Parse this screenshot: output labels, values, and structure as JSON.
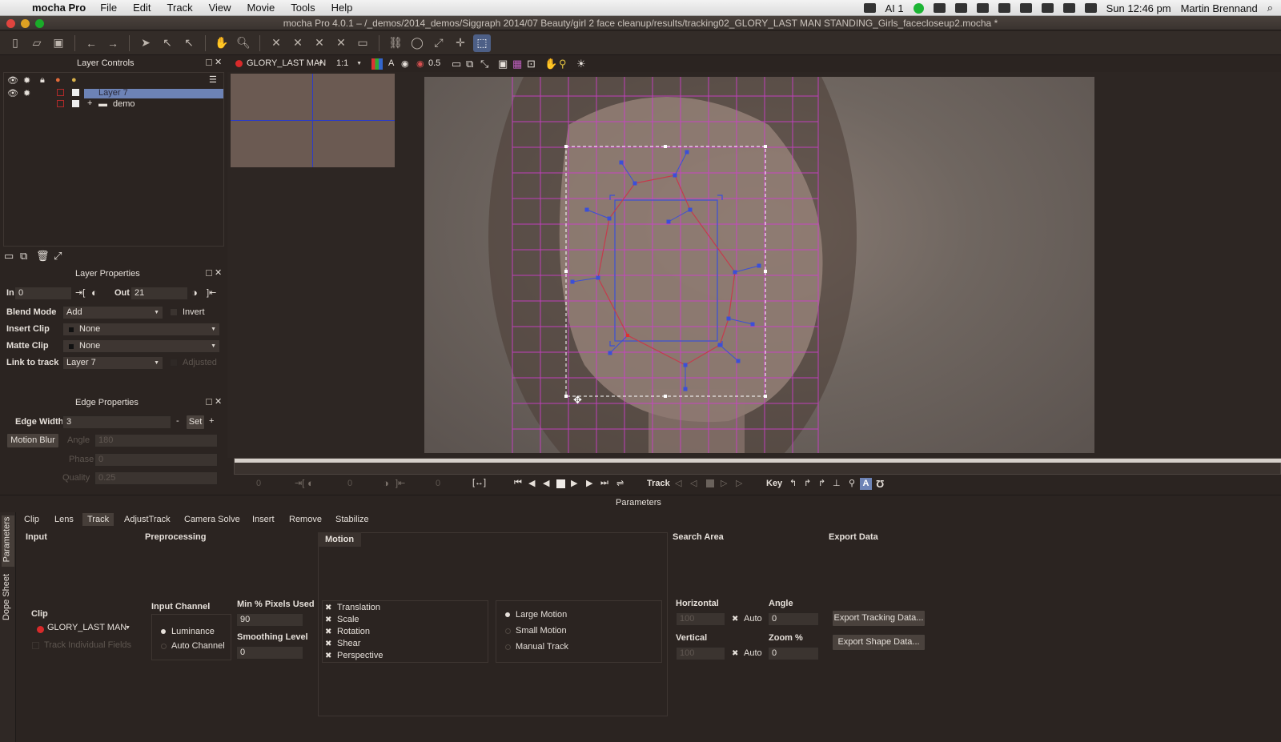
{
  "menubar": {
    "app": "mocha Pro",
    "items": [
      "File",
      "Edit",
      "Track",
      "View",
      "Movie",
      "Tools",
      "Help"
    ],
    "status_ai": "AI 1",
    "clock": "Sun 12:46 pm",
    "user": "Martin Brennand"
  },
  "window": {
    "title": "mocha Pro 4.0.1 – /_demos/2014_demos/Siggraph 2014/07 Beauty/girl 2 face cleanup/results/tracking02_GLORY_LAST MAN STANDING_Girls_facecloseup2.mocha *"
  },
  "layer_controls": {
    "title": "Layer Controls",
    "layers": [
      {
        "name": "Layer 7",
        "selected": true
      },
      {
        "name": "demo",
        "selected": false
      }
    ]
  },
  "viewer": {
    "clip_name": "GLORY_LAST MAN",
    "zoom": "1:1",
    "channel": "A",
    "opacity": "0.5"
  },
  "layer_properties": {
    "title": "Layer Properties",
    "in_label": "In",
    "in_value": "0",
    "out_label": "Out",
    "out_value": "21",
    "blend_mode_label": "Blend Mode",
    "blend_mode": "Add",
    "invert_label": "Invert",
    "insert_clip_label": "Insert Clip",
    "insert_clip": "None",
    "matte_clip_label": "Matte Clip",
    "matte_clip": "None",
    "link_to_track_label": "Link to track",
    "link_to_track": "Layer 7",
    "adjusted_label": "Adjusted"
  },
  "edge_properties": {
    "title": "Edge Properties",
    "edge_width_label": "Edge Width",
    "edge_width": "3",
    "set_label": "Set",
    "minus_label": "-",
    "plus_label": "+",
    "motion_blur_label": "Motion Blur",
    "angle_label": "Angle",
    "angle_value": "180",
    "phase_label": "Phase",
    "phase_value": "0",
    "quality_label": "Quality",
    "quality_value": "0.25"
  },
  "transport": {
    "track_label": "Track",
    "key_label": "Key"
  },
  "parameters": {
    "title": "Parameters",
    "side_tabs": [
      "Parameters",
      "Dope Sheet"
    ],
    "tabs": [
      "Clip",
      "Lens",
      "Track",
      "AdjustTrack",
      "Camera Solve",
      "Insert",
      "Remove",
      "Stabilize"
    ],
    "active_tab": "Track",
    "input": {
      "title": "Input",
      "clip_label": "Clip",
      "clip_value": "GLORY_LAST MAN",
      "track_individual_fields": "Track Individual Fields"
    },
    "preprocessing": {
      "title": "Preprocessing",
      "input_channel_label": "Input Channel",
      "luminance": "Luminance",
      "auto_channel": "Auto Channel",
      "min_pixels_label": "Min % Pixels Used",
      "min_pixels_value": "90",
      "smoothing_label": "Smoothing Level",
      "smoothing_value": "0"
    },
    "motion": {
      "title": "Motion",
      "options": [
        "Translation",
        "Scale",
        "Rotation",
        "Shear",
        "Perspective"
      ],
      "modes": [
        "Large Motion",
        "Small Motion",
        "Manual Track"
      ],
      "selected_mode": "Large Motion"
    },
    "search_area": {
      "title": "Search Area",
      "horizontal_label": "Horizontal",
      "horizontal_value": "100",
      "vertical_label": "Vertical",
      "vertical_value": "100",
      "auto_label": "Auto",
      "angle_label": "Angle",
      "angle_value": "0",
      "zoom_label": "Zoom %",
      "zoom_value": "0"
    },
    "export_data": {
      "title": "Export Data",
      "export_tracking": "Export Tracking Data...",
      "export_shape": "Export Shape Data..."
    }
  }
}
